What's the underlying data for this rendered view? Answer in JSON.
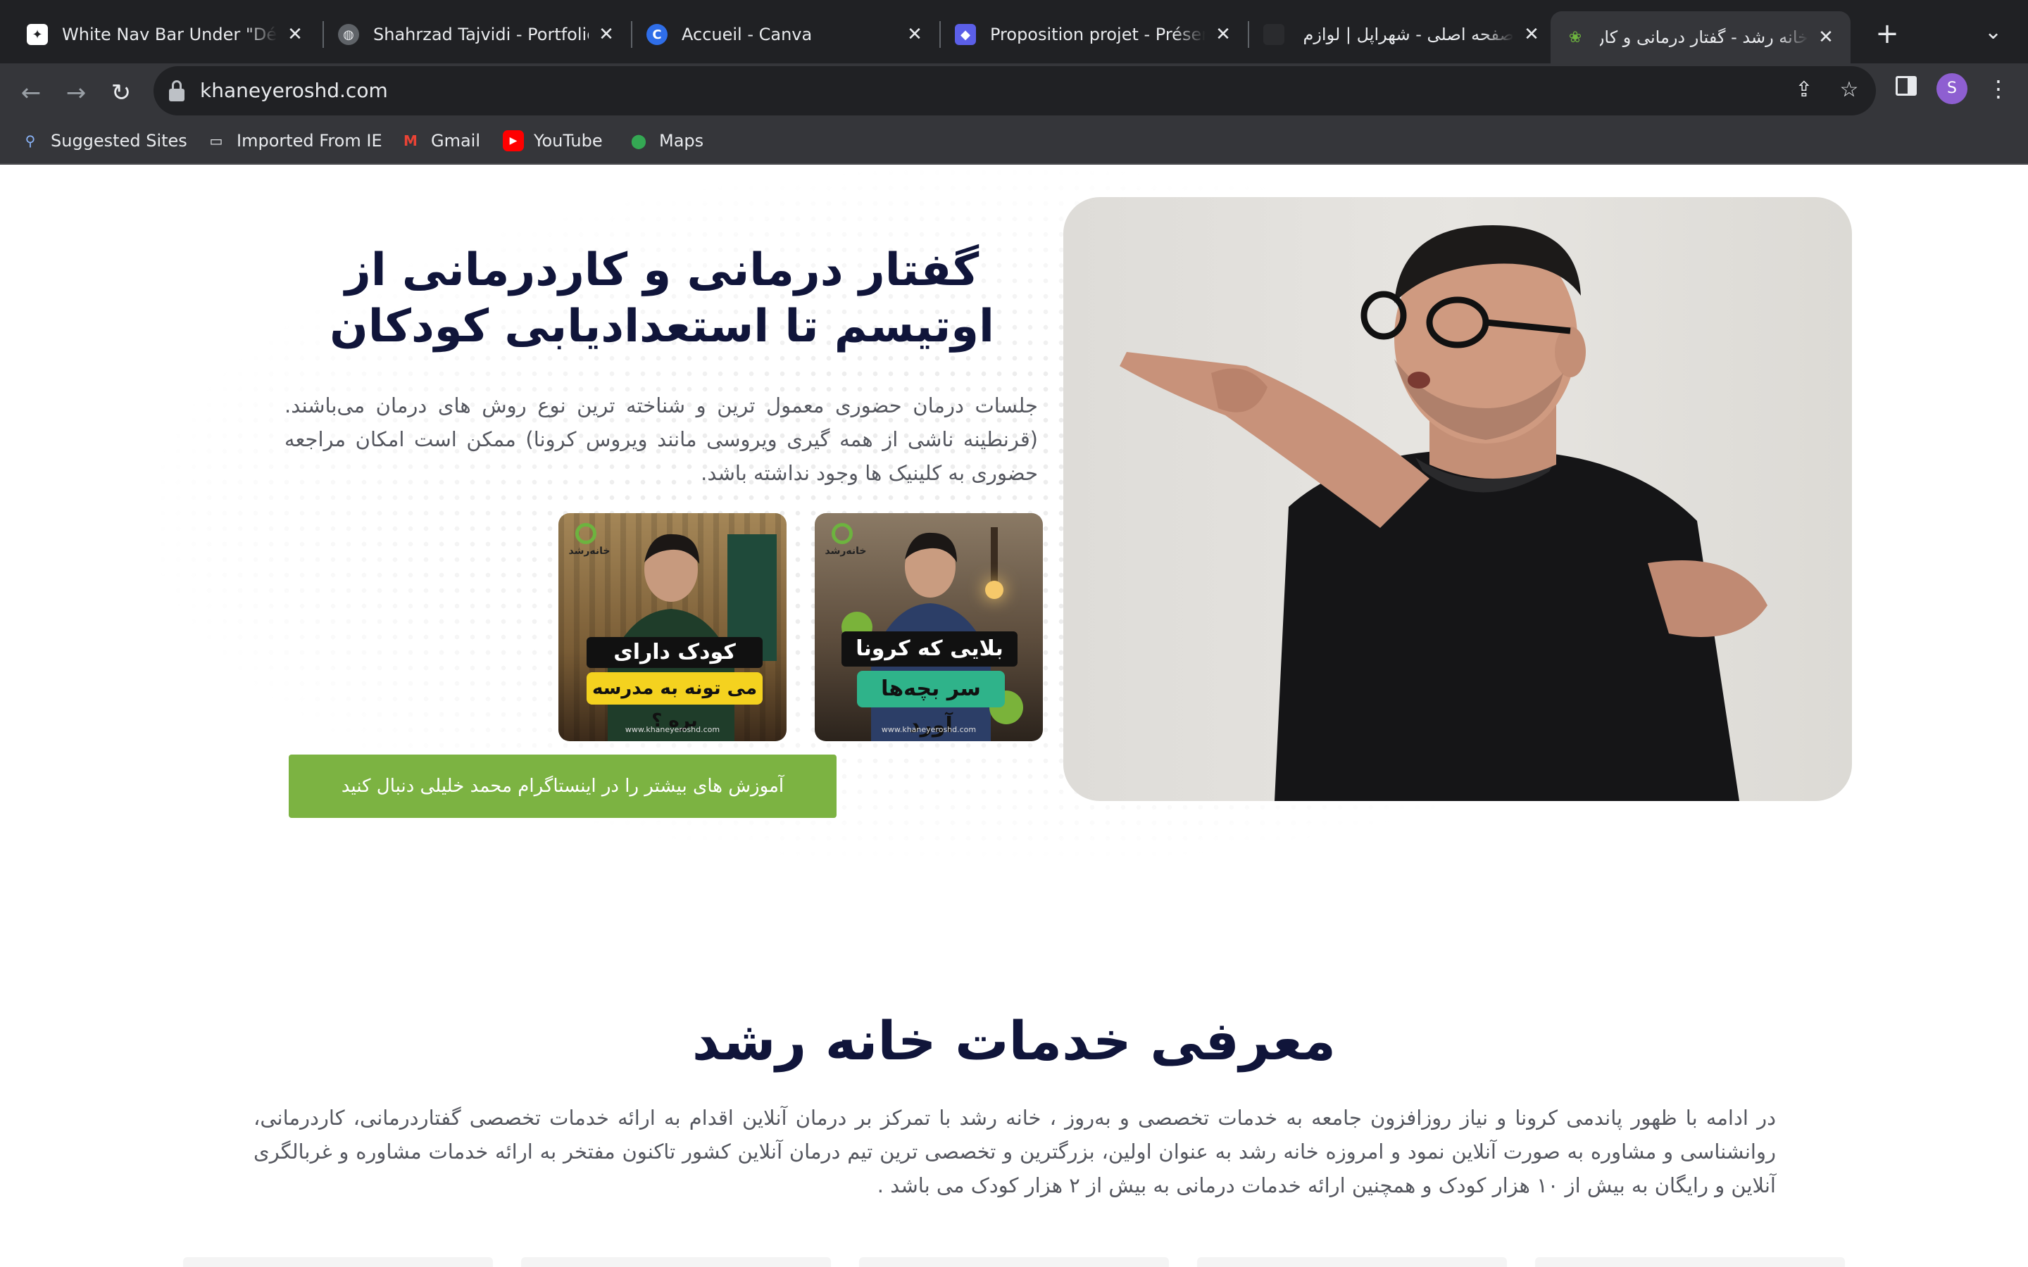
{
  "browser": {
    "tabs": [
      {
        "title": "White Nav Bar Under \"Déve",
        "icon": "chatgpt-icon",
        "color": "#ffffff"
      },
      {
        "title": "Shahrzad Tajvidi - Portfolio",
        "icon": "globe-icon",
        "color": "#bdc1c6"
      },
      {
        "title": "Accueil - Canva",
        "icon": "canva-icon",
        "color": "#2f6ee8"
      },
      {
        "title": "Proposition projet - Présent",
        "icon": "chat-bubble-icon",
        "color": "#5b5fe8"
      },
      {
        "title": "صفحه اصلی - شهراپل | لوازم جانبی",
        "icon": "app-icon",
        "color": "#202124"
      },
      {
        "title": "خانه رشد - گفتار درمانی و کاردرمانی",
        "icon": "khaneye-roshd-icon",
        "color": "#6db33f"
      }
    ],
    "active_tab": 5,
    "url": "khaneyeroshd.com",
    "bookmarks": [
      {
        "label": "Suggested Sites",
        "icon": "search-icon"
      },
      {
        "label": "Imported From IE",
        "icon": "folder-icon"
      },
      {
        "label": "Gmail",
        "icon": "gmail-icon"
      },
      {
        "label": "YouTube",
        "icon": "youtube-icon"
      },
      {
        "label": "Maps",
        "icon": "maps-pin-icon"
      }
    ],
    "profile_initial": "S"
  },
  "hero": {
    "title": "گفتار درمانی و کاردرمانی از اوتیسم تا استعدادیابی کودکان",
    "text": "جلسات درمان حضوری معمول ترین و شناخته ترین نوع روش های درمان می‌باشند. (قرنطینه ناشی از همه گیری ویروسی مانند ویروس کرونا) ممکن است امکان مراجعه حضوری به کلینیک ها وجود نداشته باشد.",
    "thumbnails": [
      {
        "logo": "خانه‌رشد",
        "headline": "کودک دارای اتیسم",
        "badge": "می تونه به مدرسه بره ؟",
        "site": "www.khaneyeroshd.com",
        "bg": "#8a6a40",
        "badge_color": "#f4d21f"
      },
      {
        "logo": "خانه‌رشد",
        "headline": "بلایی که کرونا",
        "badge": "سر بچه‌ها آورد",
        "site": "www.khaneyeroshd.com",
        "bg": "#6a5a48",
        "badge_color": "#2fb38a"
      }
    ],
    "cta_label": "آموزش های بیشتر را در اینستاگرام محمد خلیلی دنبال کنید"
  },
  "services": {
    "title": "معرفی خدمات خانه رشد",
    "text": "در ادامه با ظهور پاندمی کرونا و نیاز روزافزون جامعه به خدمات تخصصی و به‌روز ، خانه رشد با تمرکز بر درمان آنلاین اقدام به ارائه خدمات تخصصی گفتاردرمانی، کاردرمانی، روانشناسی و مشاوره به صورت آنلاین نمود و امروزه خانه رشد به عنوان اولین، بزرگترین و تخصصی ترین تیم درمان آنلاین کشور تاکنون مفتخر به ارائه خدمات مشاوره و غربالگری آنلاین و رایگان به بیش از ۱۰ هزار کودک و همچنین ارائه خدمات درمانی به بیش از ۲ هزار کودک می باشد ."
  },
  "colors": {
    "accent_green": "#7cb342",
    "heading_navy": "#10153a",
    "body_gray": "#55575f"
  }
}
